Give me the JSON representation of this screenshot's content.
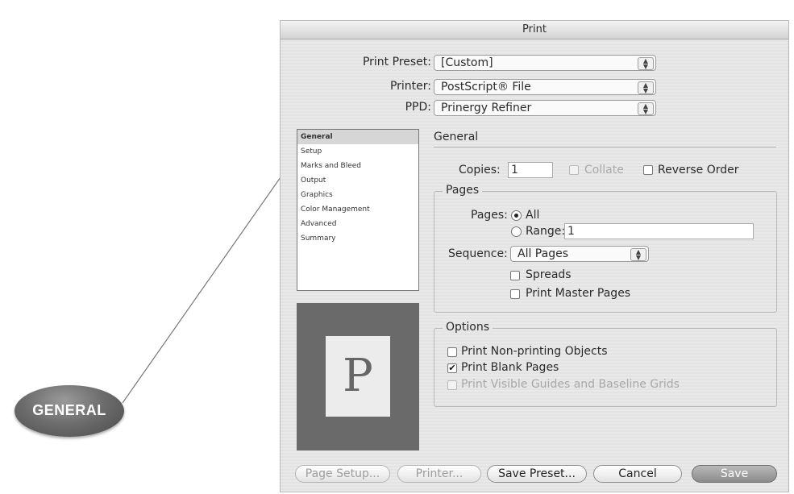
{
  "callout": {
    "label": "GENERAL"
  },
  "dialog": {
    "title": "Print",
    "print_preset": {
      "label": "Print Preset:",
      "value": "[Custom]"
    },
    "printer": {
      "label": "Printer:",
      "value": "PostScript® File"
    },
    "ppd": {
      "label": "PPD:",
      "value": "Prinergy Refiner"
    },
    "categories": [
      "General",
      "Setup",
      "Marks and Bleed",
      "Output",
      "Graphics",
      "Color Management",
      "Advanced",
      "Summary"
    ],
    "selected_category": "General",
    "preview_letter": "P",
    "general": {
      "title": "General",
      "copies_label": "Copies:",
      "copies_value": "1",
      "collate_label": "Collate",
      "reverse_order_label": "Reverse Order"
    },
    "pages": {
      "legend": "Pages",
      "pages_label": "Pages:",
      "all_label": "All",
      "range_label": "Range:",
      "range_value": "1",
      "sequence_label": "Sequence:",
      "sequence_value": "All Pages",
      "spreads_label": "Spreads",
      "print_master_pages_label": "Print Master Pages"
    },
    "options": {
      "legend": "Options",
      "non_printing_label": "Print Non-printing Objects",
      "blank_pages_label": "Print Blank Pages",
      "blank_pages_checked": true,
      "guides_label": "Print Visible Guides and Baseline Grids"
    },
    "buttons": {
      "page_setup": "Page Setup...",
      "printer": "Printer...",
      "save_preset": "Save Preset...",
      "cancel": "Cancel",
      "save": "Save"
    }
  }
}
